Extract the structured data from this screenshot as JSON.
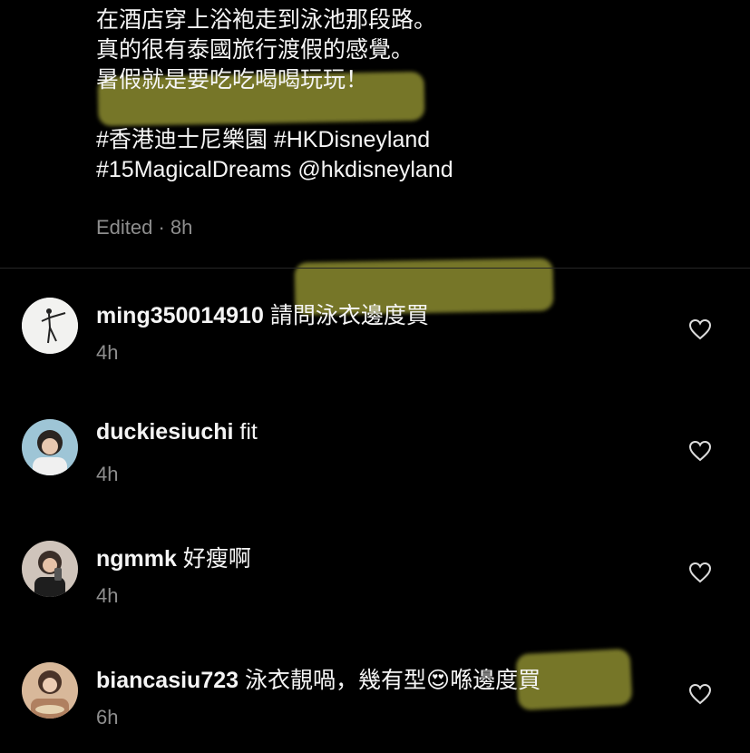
{
  "caption": {
    "lines": [
      "在酒店穿上浴袍走到泳池那段路。",
      "真的很有泰國旅行渡假的感覺。",
      "暑假就是要吃吃喝喝玩玩！"
    ],
    "hashtags_line1": "#香港迪士尼樂園 #HKDisneyland",
    "hashtags_line2": "#15MagicalDreams @hkdisneyland"
  },
  "post_meta": "Edited · 8h",
  "highlight_color": "#d8d84a",
  "comments": [
    {
      "user": "ming350014910",
      "text": "請問泳衣邊度買",
      "time": "4h",
      "avatar": "ballerina-avatar"
    },
    {
      "user": "duckiesiuchi",
      "text": "fit",
      "time": "4h",
      "avatar": "user-avatar"
    },
    {
      "user": "ngmmk",
      "text": "好瘦啊",
      "time": "4h",
      "avatar": "selfie-avatar"
    },
    {
      "user": "biancasiu723",
      "text_before_emoji": "泳衣靚喎，幾有型",
      "emoji": "😍",
      "text_after_emoji": "喺邊度買",
      "time": "6h",
      "avatar": "user-avatar"
    }
  ],
  "icons": {
    "like": "heart-icon"
  }
}
